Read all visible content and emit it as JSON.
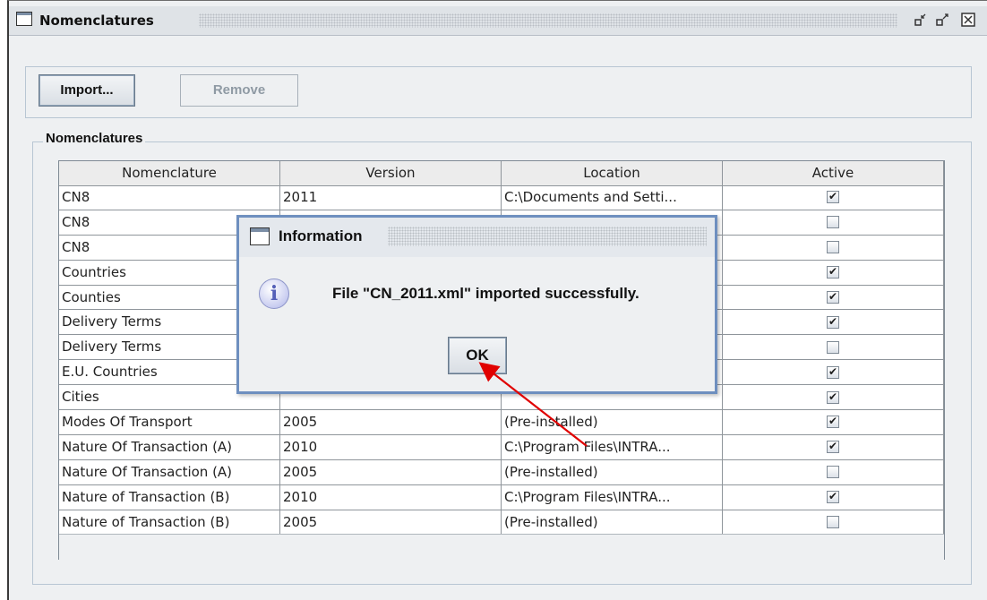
{
  "frame": {
    "title": "Nomenclatures",
    "icons": [
      "window-icon",
      "minimize-icon",
      "maximize-icon",
      "close-icon"
    ]
  },
  "toolbar": {
    "import_label": "Import...",
    "remove_label": "Remove"
  },
  "group": {
    "label": "Nomenclatures"
  },
  "table": {
    "columns": [
      "Nomenclature",
      "Version",
      "Location",
      "Active"
    ],
    "rows": [
      {
        "nomenclature": "CN8",
        "version": "2011",
        "location": "C:\\Documents and Setti...",
        "active": true
      },
      {
        "nomenclature": "CN8",
        "version": "",
        "location": "",
        "active": false
      },
      {
        "nomenclature": "CN8",
        "version": "",
        "location": "",
        "active": false
      },
      {
        "nomenclature": "Countries",
        "version": "",
        "location": "",
        "active": true
      },
      {
        "nomenclature": "Counties",
        "version": "",
        "location": "",
        "active": true
      },
      {
        "nomenclature": "Delivery Terms",
        "version": "",
        "location": "",
        "active": true
      },
      {
        "nomenclature": "Delivery Terms",
        "version": "",
        "location": "",
        "active": false
      },
      {
        "nomenclature": "E.U. Countries",
        "version": "",
        "location": "",
        "active": true
      },
      {
        "nomenclature": "Cities",
        "version": "",
        "location": "",
        "active": true
      },
      {
        "nomenclature": "Modes Of Transport",
        "version": "2005",
        "location": "(Pre-installed)",
        "active": true
      },
      {
        "nomenclature": "Nature Of Transaction (A)",
        "version": "2010",
        "location": "C:\\Program Files\\INTRA...",
        "active": true
      },
      {
        "nomenclature": "Nature Of Transaction (A)",
        "version": "2005",
        "location": "(Pre-installed)",
        "active": false
      },
      {
        "nomenclature": "Nature of Transaction (B)",
        "version": "2010",
        "location": "C:\\Program Files\\INTRA...",
        "active": true
      },
      {
        "nomenclature": "Nature of Transaction (B)",
        "version": "2005",
        "location": "(Pre-installed)",
        "active": false
      }
    ]
  },
  "dialog": {
    "title": "Information",
    "icon": "info-icon",
    "message": "File \"CN_2011.xml\" imported successfully.",
    "ok_label": "OK"
  },
  "annotation": {
    "arrow_color": "#e00000"
  },
  "colors": {
    "background": "#eef0f2",
    "dialog_border": "#6e8fbf"
  }
}
